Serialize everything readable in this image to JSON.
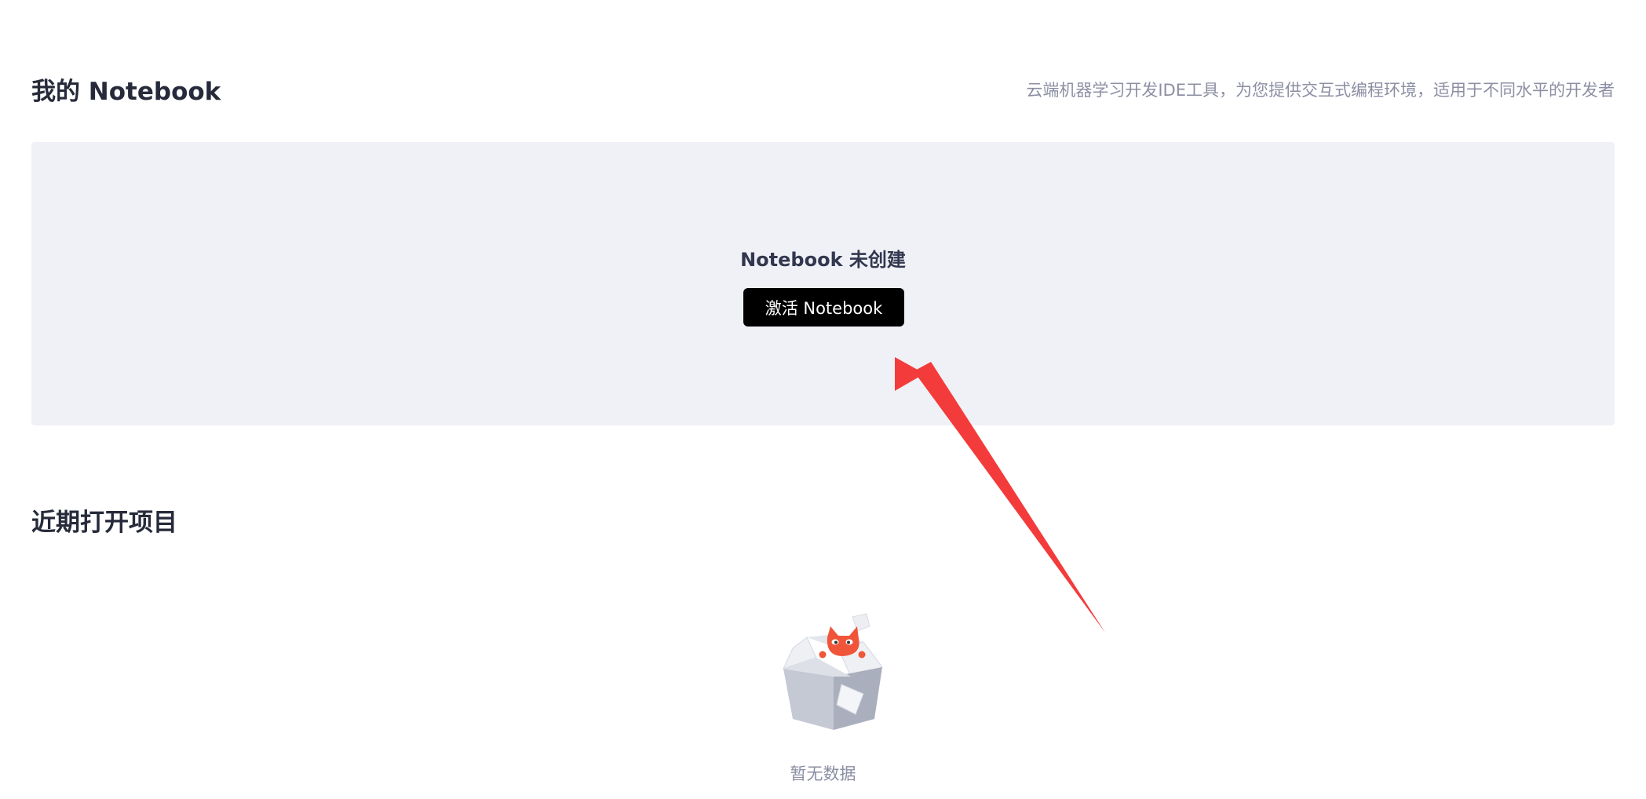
{
  "header": {
    "title": "我的 Notebook",
    "subtitle": "云端机器学习开发IDE工具，为您提供交互式编程环境，适用于不同水平的开发者"
  },
  "notebook_panel": {
    "status": "Notebook 未创建",
    "activate_label": "激活 Notebook"
  },
  "recent": {
    "title": "近期打开项目",
    "empty_text": "暂无数据",
    "empty_icon": "empty-box-cat-icon"
  },
  "colors": {
    "panel_bg": "#f0f1f6",
    "button_bg": "#000000",
    "arrow": "#f43b3b",
    "mascot": "#f0553a"
  }
}
